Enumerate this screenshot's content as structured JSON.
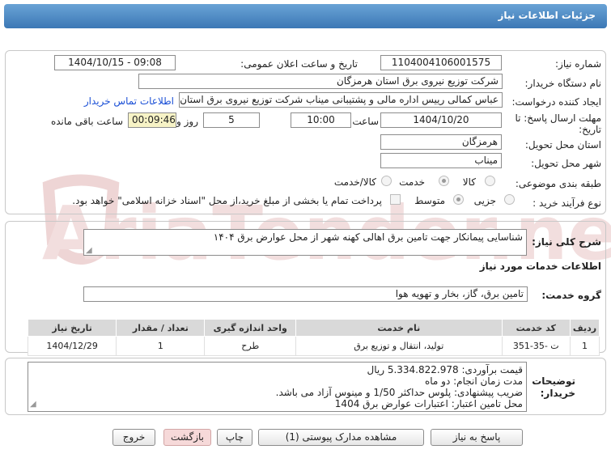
{
  "header": {
    "title": "جزئیات اطلاعات نیاز"
  },
  "form": {
    "need_number_label": "شماره نیاز:",
    "need_number": "1104004106001575",
    "announce_label": "تاریخ و ساعت اعلان عمومی:",
    "announce_value": "1404/10/15 - 09:08",
    "buyer_label": "نام دستگاه خریدار:",
    "buyer_value": "شرکت توزیع نیروی برق استان هرمزگان",
    "creator_label": "ایجاد کننده درخواست:",
    "creator_value": "عباس کمالی رییس اداره مالی و پشتیبانی میناب شرکت توزیع نیروی برق استان",
    "contact_link": "اطلاعات تماس خریدار",
    "deadline_label_1": "مهلت ارسال پاسخ: تا",
    "deadline_label_2": "تاریخ:",
    "deadline_date": "1404/10/20",
    "time_label": "ساعت",
    "deadline_time": "10:00",
    "days_value": "5",
    "days_label": "روز و",
    "remaining_time": "00:09:46",
    "remaining_label": "ساعت باقی مانده",
    "province_label": "استان محل تحویل:",
    "province_value": "هرمزگان",
    "city_label": "شهر محل تحویل:",
    "city_value": "میناب",
    "category_label": "طبقه بندی موضوعی:",
    "category_options": [
      "کالا",
      "خدمت",
      "کالا/خدمت"
    ],
    "category_selected": "خدمت",
    "purchase_label": "نوع فرآیند خرید :",
    "purchase_options": [
      "جزیی",
      "متوسط"
    ],
    "purchase_selected": "متوسط",
    "payment_note": "پرداخت تمام یا بخشی از مبلغ خرید،از محل \"اسناد خزانه اسلامی\" خواهد بود."
  },
  "summary": {
    "label": "شرح کلی نیاز:",
    "value": "شناسایی پیمانکار جهت تامین برق اهالی کهنه شهر از محل عوارض برق ۱۴۰۴"
  },
  "services": {
    "section_title": "اطلاعات خدمات مورد نیاز",
    "group_label": "گروه خدمت:",
    "group_value": "تامین برق، گاز، بخار و تهویه هوا",
    "columns": [
      "ردیف",
      "کد خدمت",
      "نام خدمت",
      "واحد اندازه گیری",
      "تعداد / مقدار",
      "تاریخ نیاز"
    ],
    "rows": [
      [
        "1",
        "ت -35-351",
        "تولید، انتقال و توزیع برق",
        "طرح",
        "1",
        "1404/12/29"
      ]
    ]
  },
  "buyer_notes": {
    "label_1": "توضیحات",
    "label_2": "خریدار:",
    "lines": [
      "قیمت برآوردی:  5.334.822.978  ریال",
      "مدت زمان انجام: دو ماه",
      "ضریب پیشنهادی: پلوس  حداکثر 1/50 و مینوس آزاد می باشد.",
      "محل تامین اعتبار:  اعتبارات عوارض برق 1404"
    ]
  },
  "buttons": {
    "reply": "پاسخ به نیاز",
    "attachments": "مشاهده مدارک پیوستی (1)",
    "print": "چاپ",
    "back": "بازگشت",
    "exit": "خروج"
  },
  "watermark": {
    "text": "AriaTender.net"
  },
  "colors": {
    "title_bar": "#3c78b5",
    "link": "#1a4fd6",
    "watermark": "#f0d6d6"
  }
}
